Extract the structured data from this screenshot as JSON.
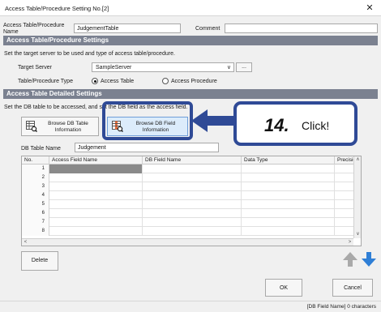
{
  "window": {
    "title": "Access Table/Procedure Setting No.[2]"
  },
  "header": {
    "name_label": "Access Table/Procedure Name",
    "name_value": "JudgementTable",
    "comment_label": "Comment",
    "comment_value": ""
  },
  "settings": {
    "section_title": "Access Table/Procedure Settings",
    "description": "Set the target server to be used and type of access table/procedure.",
    "target_server_label": "Target Server",
    "target_server_value": "SampleServer",
    "ellipsis_label": "...",
    "type_label": "Table/Procedure Type",
    "type_options": [
      "Access Table",
      "Access Procedure"
    ],
    "type_selected": "Access Table"
  },
  "detailed": {
    "section_title": "Access Table Detailed Settings",
    "description": "Set the DB table to be accessed, and set the DB field as the access field.",
    "browse_table_label": "Browse DB Table Information",
    "browse_field_label": "Browse DB Field Information",
    "db_table_name_label": "DB Table Name",
    "db_table_name_value": "Judgement"
  },
  "grid": {
    "columns": [
      "No.",
      "Access Field Name",
      "DB Field Name",
      "Data Type",
      "Precisio"
    ],
    "rows": [
      "1",
      "2",
      "3",
      "4",
      "5",
      "6",
      "7",
      "8"
    ],
    "current_row_marker": "▶"
  },
  "callout": {
    "step": "14.",
    "text": "Click!"
  },
  "buttons": {
    "delete": "Delete",
    "ok": "OK",
    "cancel": "Cancel"
  },
  "status": {
    "text": "[DB Field Name]  0 characters"
  },
  "colors": {
    "section_bg": "#7b8190",
    "highlight": "#2f4a96",
    "move_up": "#a9a9a9",
    "move_down": "#2f7fd6"
  }
}
